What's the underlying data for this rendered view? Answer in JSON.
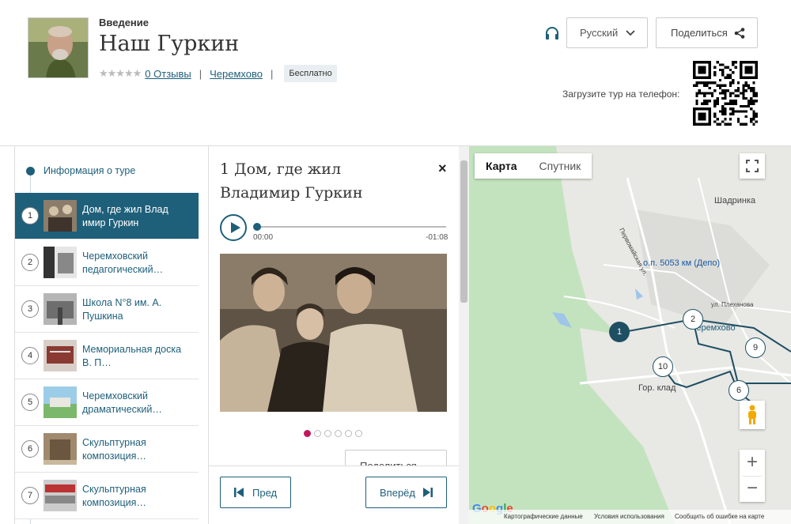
{
  "header": {
    "subtitle": "Введение",
    "title": "Наш Гуркин",
    "stars": "★★★★★",
    "reviews_link": "0 Отзывы",
    "location_link": "Черемхово",
    "price_badge": "Бесплатно",
    "language_select": "Русский",
    "share_label": "Поделиться",
    "qr_label": "Загрузите тур на телефон:"
  },
  "sidebar": {
    "info_item": "Информация о туре",
    "stops": [
      {
        "num": "1",
        "label": "Дом, где жил Влад имир Гуркин",
        "active": true
      },
      {
        "num": "2",
        "label": "Черемховский педагогический…",
        "active": false
      },
      {
        "num": "3",
        "label": "Школа N°8 им. А. Пушкина",
        "active": false
      },
      {
        "num": "4",
        "label": "Мемориальная доска В. П…",
        "active": false
      },
      {
        "num": "5",
        "label": "Черемховский драматический…",
        "active": false
      },
      {
        "num": "6",
        "label": "Скульптурная композиция…",
        "active": false
      },
      {
        "num": "7",
        "label": "Скульптурная композиция…",
        "active": false
      }
    ]
  },
  "detail": {
    "title": "1 Дом, где жил Владимир Гуркин",
    "close": "×",
    "audio_start": "00:00",
    "audio_end": "-01:08",
    "share_label": "Поделиться",
    "prev_label": "Пред",
    "next_label": "Вперёд"
  },
  "map": {
    "tab_map": "Карта",
    "tab_satellite": "Спутник",
    "labels": {
      "shadrinka": "Шадринка",
      "station": "о.п. 5053 км (Депо)",
      "street": "ул. Плеханова",
      "street2": "Первомайская ул.",
      "city": "Черемхово",
      "klad": "Гор. клад"
    },
    "markers": [
      "1",
      "2",
      "9",
      "10",
      "6"
    ],
    "footer": {
      "data": "Картографические данные",
      "terms": "Условия использования",
      "report": "Сообщить об ошибке на карте"
    },
    "brand": "Google"
  },
  "colors": {
    "accent": "#1e5f7a",
    "active_dot": "#c2185b"
  }
}
